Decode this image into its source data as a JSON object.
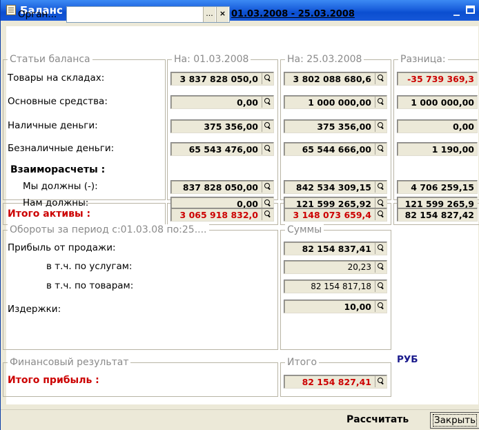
{
  "window": {
    "title": "Баланс",
    "min_glyph": "_",
    "close_glyph": "✕"
  },
  "filter": {
    "org_label": "Орган...",
    "org_value": "",
    "select_glyph": "...",
    "clear_glyph": "×",
    "period": "01.03.2008 - 25.03.2008"
  },
  "sections": {
    "balance_items": "Статьи баланса",
    "col_start": "На: 01.03.2008",
    "col_end": "На: 25.03.2008",
    "col_diff": "Разница:",
    "turnover": "Обороты за период с:01.03.08 по:25....",
    "sums": "Суммы",
    "fin_result": "Финансовый результат",
    "total": "Итого"
  },
  "rows": [
    {
      "label": "Товары на складах:",
      "start": "3 837 828 050,0",
      "end": "3 802 088 680,6",
      "diff": "-35 739 369,3"
    },
    {
      "label": "Основные средства:",
      "start": "0,00",
      "end": "1 000 000,00",
      "diff": "1 000 000,00"
    },
    {
      "label": "Наличные деньги:",
      "start": "375 356,00",
      "end": "375 356,00",
      "diff": "0,00"
    },
    {
      "label": "Безналичные деньги:",
      "start": "65 543 476,00",
      "end": "65 544 666,00",
      "diff": "1 190,00"
    }
  ],
  "settlements": {
    "header": "Взаиморасчеты :",
    "rows": [
      {
        "label": "Мы должны (-):",
        "start": "837 828 050,00",
        "end": "842 534 309,15",
        "diff": "4 706 259,15"
      },
      {
        "label": "Нам должны:",
        "start": "0,00",
        "end": "121 599 265,92",
        "diff": "121 599 265,9"
      }
    ]
  },
  "assets_total": {
    "label": "Итого активы :",
    "start": "3 065 918 832,0",
    "end": "3 148 073 659,4",
    "diff": "82 154 827,42"
  },
  "turnover": {
    "rows": [
      {
        "label": "Прибыль от продажи:",
        "value": "82 154 837,41"
      },
      {
        "label": "в т.ч. по услугам:",
        "value": "20,23"
      },
      {
        "label": "в т.ч. по товарам:",
        "value": "82 154 817,18"
      },
      {
        "label": "Издержки:",
        "value": "10,00"
      }
    ]
  },
  "profit": {
    "label": "Итого прибыль :",
    "value": "82 154 827,41",
    "currency": "РУБ"
  },
  "buttons": {
    "calculate": "Рассчитать",
    "close": "Закрыть"
  }
}
